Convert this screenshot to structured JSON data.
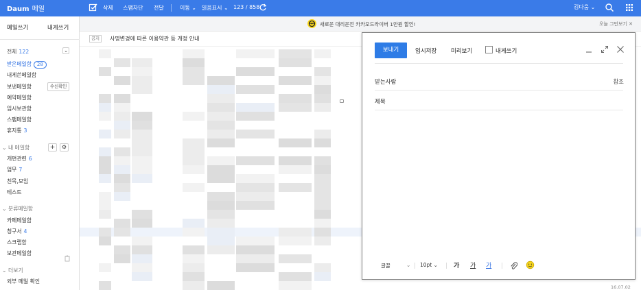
{
  "brand": {
    "logo": "Daum",
    "service": "메일"
  },
  "toolbar": {
    "delete": "삭제",
    "spam": "스팸차단",
    "forward": "전달",
    "move": "이동",
    "mark_read": "읽음표시",
    "count_current": "123",
    "count_total": "858",
    "user": "김다움"
  },
  "sidebar": {
    "write_mail": "메일쓰기",
    "write_self": "내게쓰기",
    "all_label": "전체",
    "all_count": "122",
    "inbox": "받은메일함",
    "inbox_count": "28",
    "to_me": "내게쓴메일함",
    "sent": "보낸메일함",
    "receipt_check": "수신확인",
    "reserved": "예약메일함",
    "drafts": "임시보관함",
    "spam": "스팸메일함",
    "trash": "휴지통",
    "trash_count": "3",
    "my_folders": "내 메일함",
    "folders": [
      {
        "name": "개편관련",
        "count": "6"
      },
      {
        "name": "업무",
        "count": "7"
      },
      {
        "name": "친목,모임",
        "count": ""
      },
      {
        "name": "테스트",
        "count": ""
      }
    ],
    "categories": "분류메일함",
    "cat_items": [
      {
        "name": "카페메일함",
        "count": ""
      },
      {
        "name": "청구서",
        "count": "4"
      },
      {
        "name": "스크랩함",
        "count": ""
      },
      {
        "name": "보관메일함",
        "count": ""
      }
    ],
    "more": "더보기",
    "external": "외부 메일 확인"
  },
  "notice_bar": {
    "text": "새로운 대리운전 카카오드라이버 1만원 할인!",
    "close": "오늘 그만보기"
  },
  "list": {
    "notice_tag": "공지",
    "notice_title": "사명변경에 따른 이용약관 등 개정 안내",
    "last_date": "16.07.02"
  },
  "compose": {
    "send": "보내기",
    "save_draft": "임시저장",
    "preview": "미리보기",
    "to_self": "내게쓰기",
    "to_label": "받는사람",
    "cc": "참조",
    "subject_label": "제목",
    "font": "글꼴",
    "font_size": "10pt",
    "bold": "가",
    "underline": "가",
    "color": "가"
  },
  "colors": {
    "accent": "#3a7be8",
    "send_button": "#2e7ce6",
    "notice_icon": "#f8d61c"
  }
}
